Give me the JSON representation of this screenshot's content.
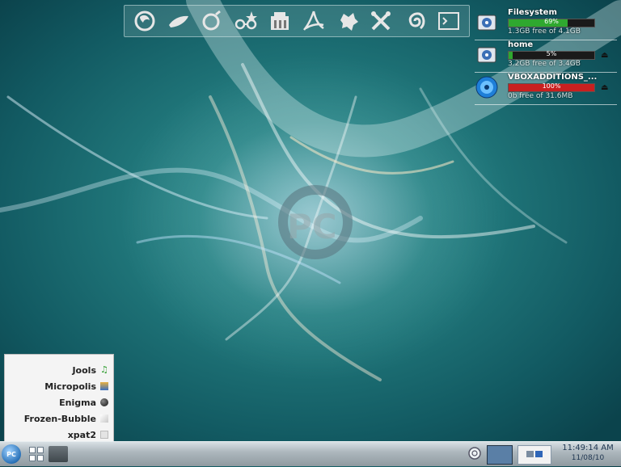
{
  "desktop": {
    "dock_items": [
      {
        "icon": "firefox-icon"
      },
      {
        "icon": "gimp-icon"
      },
      {
        "icon": "beagle-ring-icon"
      },
      {
        "icon": "search-glasses-icon"
      },
      {
        "icon": "office-suite-icon"
      },
      {
        "icon": "pdf-reader-icon"
      },
      {
        "icon": "gear-leaf-icon"
      },
      {
        "icon": "system-tools-icon"
      },
      {
        "icon": "swirl-icon"
      },
      {
        "icon": "terminal-icon"
      }
    ]
  },
  "drives": [
    {
      "name": "Filesystem",
      "percent": "69%",
      "fill": 0.69,
      "color": "#2fa82f",
      "free": "1.3GB free of 4.1GB",
      "icon": "hard-drive-icon",
      "eject": false
    },
    {
      "name": "home",
      "percent": "5%",
      "fill": 0.05,
      "color": "#2fa82f",
      "free": "3.2GB free of 3.4GB",
      "icon": "hard-drive-icon",
      "eject": true,
      "eject_glyph": "⏏"
    },
    {
      "name": "VBOXADDITIONS_...",
      "percent": "100%",
      "fill": 1.0,
      "color": "#c82020",
      "free": "0b free of 31.6MB",
      "icon": "cdrom-icon",
      "eject": true,
      "eject_glyph": "⏏"
    }
  ],
  "menu": {
    "items": [
      {
        "label": "Jools",
        "icon": "jools-icon"
      },
      {
        "label": "Micropolis",
        "icon": "micropolis-icon"
      },
      {
        "label": "Enigma",
        "icon": "enigma-icon"
      },
      {
        "label": "Frozen-Bubble",
        "icon": "frozen-bubble-icon"
      },
      {
        "label": "xpat2",
        "icon": "xpat2-icon"
      }
    ]
  },
  "taskbar": {
    "start_label": "PC",
    "clock_time": "11:49:14 AM",
    "clock_date": "11/08/10"
  }
}
